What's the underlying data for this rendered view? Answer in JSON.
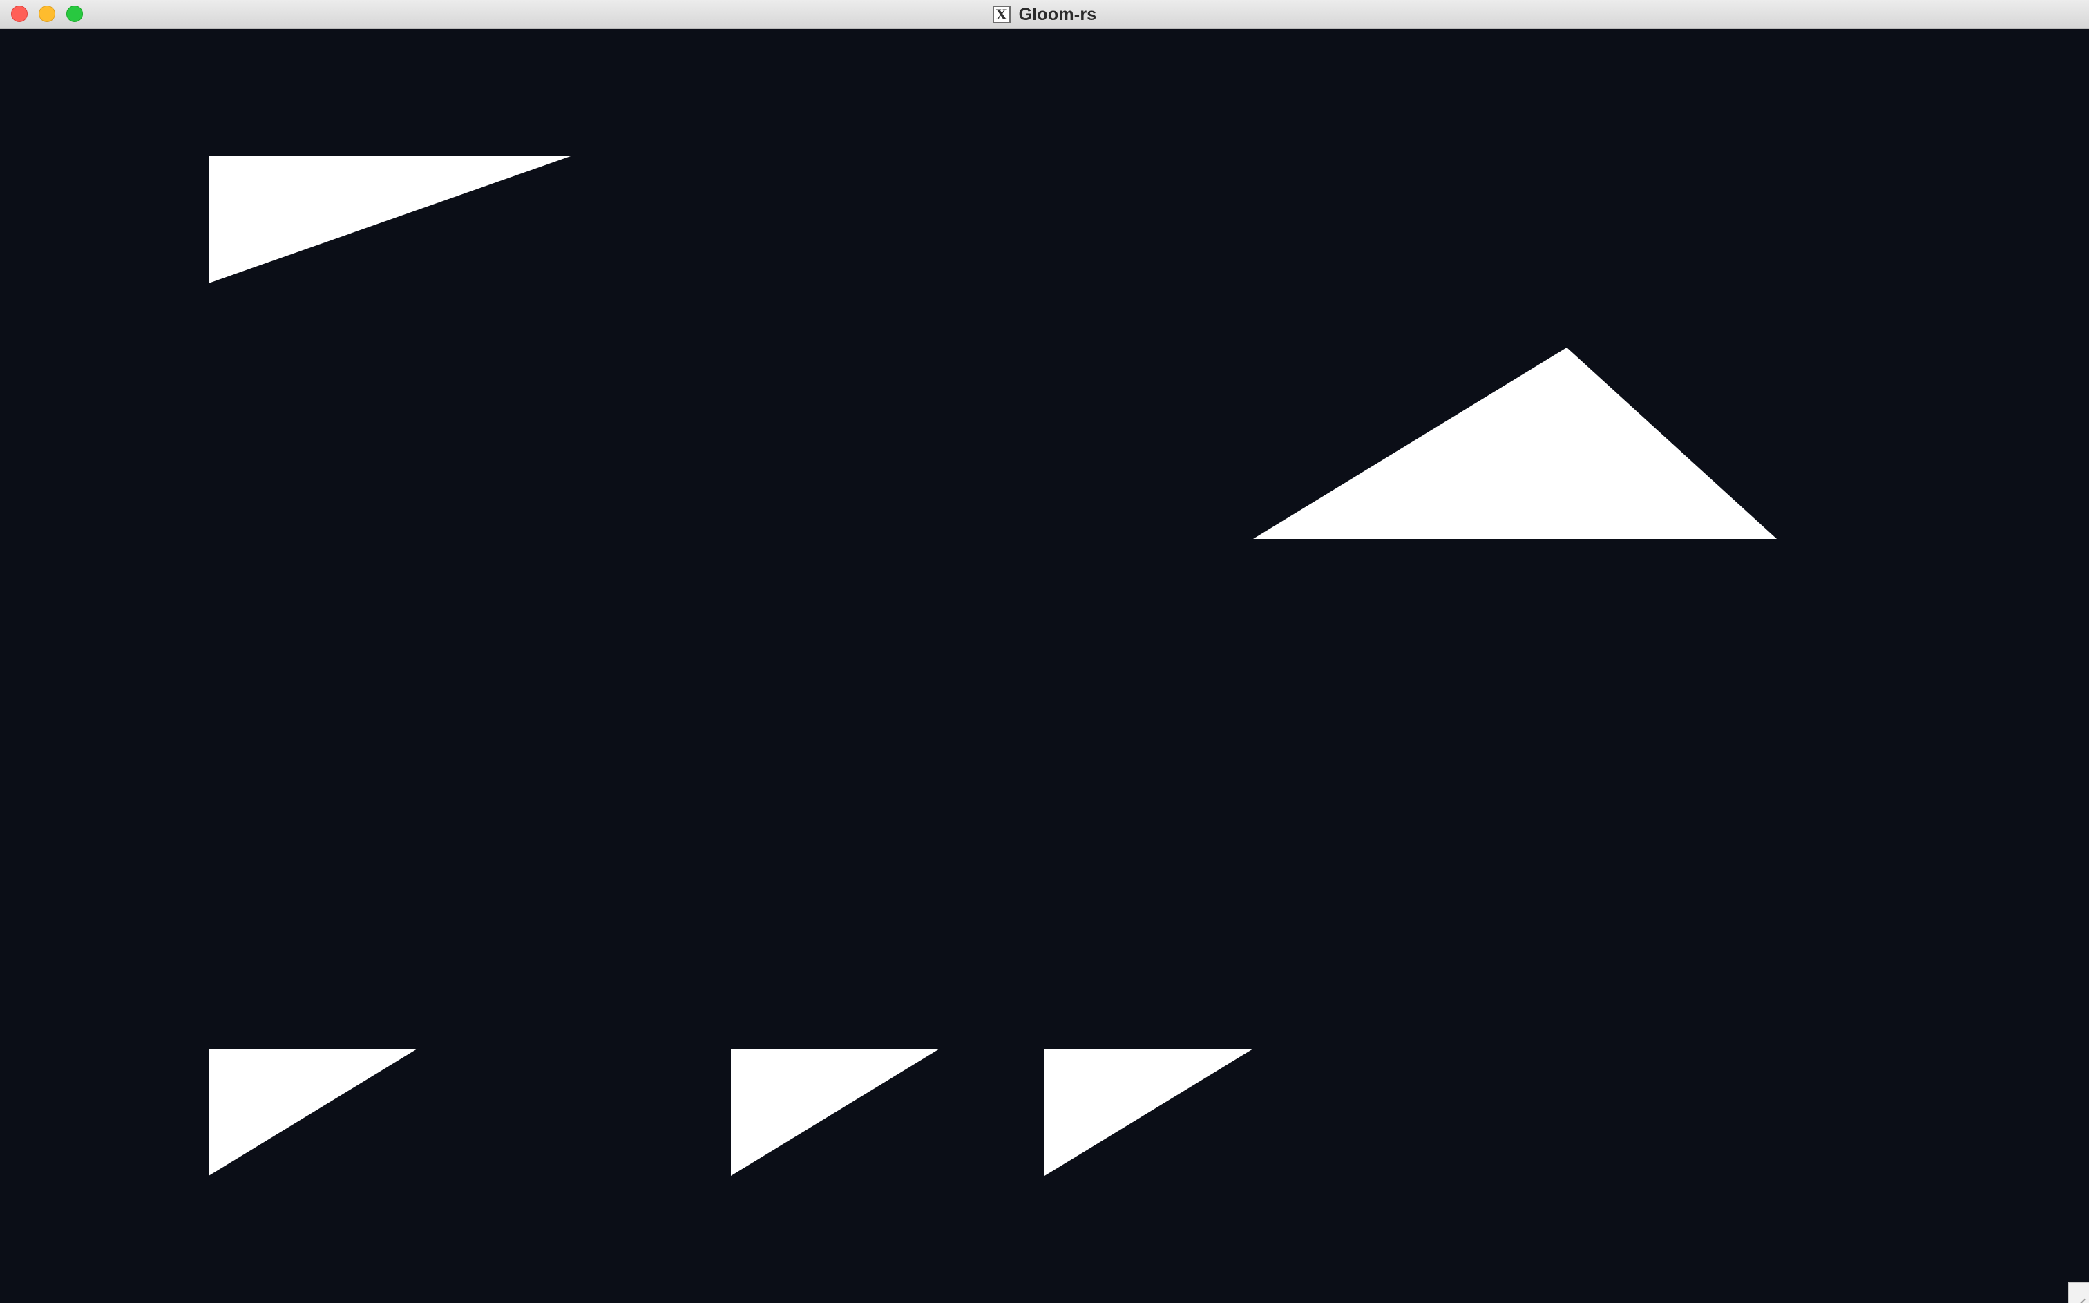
{
  "window": {
    "title": "Gloom-rs",
    "app_icon": "X",
    "background_color": "#0b0e17",
    "shape_color": "#ffffff"
  },
  "scene": {
    "shape_type": "triangle",
    "shape_count": 5
  },
  "icons": {
    "close": "close-dot",
    "minimize": "minimize-dot",
    "zoom": "zoom-dot",
    "resize": "resize-grip-icon"
  }
}
